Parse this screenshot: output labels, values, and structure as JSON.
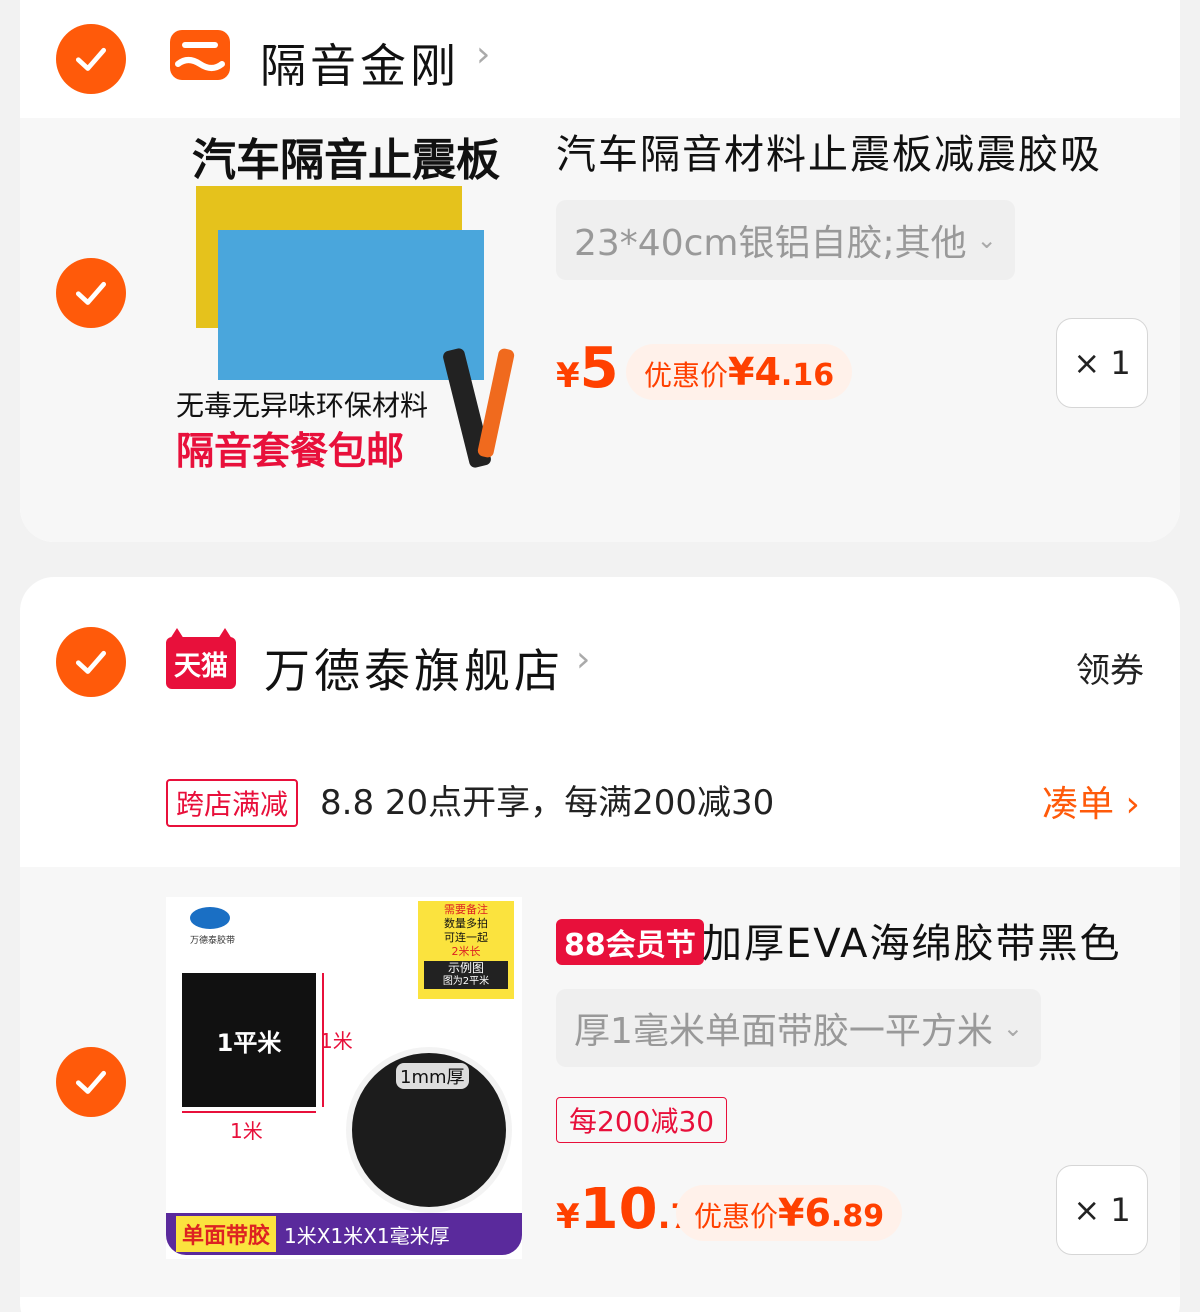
{
  "store1": {
    "name": "隔音金刚",
    "chevron": "›",
    "item": {
      "image_headline": "汽车隔音止震板",
      "image_line1": "无毒无异味环保材料",
      "image_line2": "隔音套餐包邮",
      "title": "汽车隔音材料止震板减震胶吸",
      "sku": "23*40cm银铝自胶;其他",
      "sku_arrow": "⌄",
      "price_currency": "¥",
      "price_int": "5",
      "price_dec": "",
      "deal_label": "优惠价",
      "deal_currency": "¥",
      "deal_int": "4",
      "deal_dec": ".16",
      "qty": "× 1"
    }
  },
  "store2": {
    "logo_text": "天猫",
    "name": "万德泰旗舰店",
    "chevron": "›",
    "coupon": "领券",
    "promo": {
      "tag": "跨店满减",
      "text": "8.8 20点开享，每满200减30",
      "action": "凑单 ›"
    },
    "item": {
      "image_brand": "万德泰胶带",
      "image_note1": "需要备注",
      "image_note2": "数量多拍",
      "image_note3": "可连一起",
      "image_note4": "2米长",
      "image_note5": "示例图",
      "image_note6": "图为2平米",
      "image_square": "1平米",
      "image_side": "1米",
      "image_bottom": "1米",
      "image_thick": "1mm厚",
      "image_banner_tag": "单面带胶",
      "image_banner_text": "1米X1米X1毫米厚",
      "badge": "88会员节",
      "title": "加厚EVA海绵胶带黑色",
      "sku": "厚1毫米单面带胶一平方米",
      "sku_arrow": "⌄",
      "promo_tag": "每200减30",
      "price_currency": "¥",
      "price_int": "10",
      "price_dec": ".7",
      "deal_label": "优惠价",
      "deal_currency": "¥",
      "deal_int": "6",
      "deal_dec": ".89",
      "qty": "× 1"
    }
  },
  "colors": {
    "accent": "#ff5a0a",
    "price": "#ff4000",
    "tmall": "#e8103b"
  }
}
